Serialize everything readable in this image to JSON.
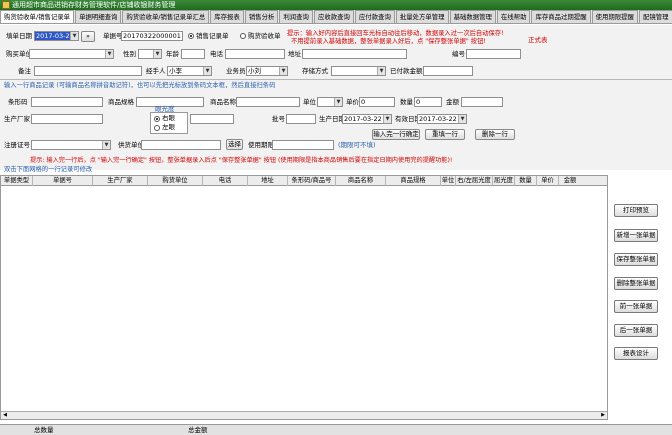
{
  "window": {
    "title": "通用超市商品进销存财务管理软件/店铺收银财务管理"
  },
  "tabs": [
    "购货验收单/销售记录单",
    "单据明细查询",
    "购货验收单/销售记录单汇总",
    "库存报表",
    "销售分析",
    "利润查询",
    "应收款查询",
    "应付款查询",
    "批量处方单管理",
    "基础数据管理",
    "在线帮助",
    "库存商品过期提醒",
    "使用期限提醒",
    "配镜管理"
  ],
  "header": {
    "date_label": "填单日期",
    "date_value": "2017-03-22",
    "goto_icon": "»",
    "docno_label": "单据号",
    "docno_value": "20170322000001",
    "radio_sales": "销售记录单",
    "radio_purchase": "购货验收单",
    "hint": "提示：输入好内容后直接回车光标自动往后移动，数据录入过一次后自动保存!",
    "hint2": "不用提前录入基础数据，整张单据录入好后，点 \"保存整张单据\" 按钮!",
    "mode_label": "正式表"
  },
  "customer": {
    "buyer_label": "购买单位",
    "gender_label": "性别",
    "age_label": "年龄",
    "phone_label": "电话",
    "address_label": "地址",
    "code_label": "编号",
    "remark_label": "备注",
    "agent_label": "经手人",
    "agent_value": "小李",
    "salesman_label": "业务员",
    "salesman_value": "小刘",
    "storage_label": "存储方式",
    "paid_label": "已付款金额"
  },
  "item_hint": "输入一行商品记录 (可输商品名称拼音助记符)，也可以先把光标放到条码文本框，然后直接扫条码",
  "item": {
    "barcode_label": "条形码",
    "spec_label": "商品规格",
    "name_label": "商品名称",
    "unit_label": "单位",
    "price_label": "单价",
    "price_value": "0",
    "qty_label": "数量",
    "qty_value": "0",
    "amount_label": "金额",
    "maker_label": "生产厂家",
    "eye_label": "眼光度",
    "eye_right": "右眼",
    "eye_left": "左眼",
    "batch_label": "批号",
    "prod_date_label": "生产日期",
    "prod_date_value": "2017-03-22",
    "expiry_label": "有效日期",
    "expiry_value": "2017-03-22",
    "enter_btn": "输入完一行确定",
    "reenter_btn": "重填一行",
    "delete_row_btn": "删除一行",
    "reg_label": "注册证号",
    "supplier_label": "供货单位",
    "choose_btn": "选择",
    "period_label": "使用期限",
    "period_note": "(期限可不填)"
  },
  "row_hint": "提示: 输入完一行后，点 \"输入完一行确定\" 按钮，整张单据录入后点 \"保存整张单据\" 按钮 (使用期限是指本商品销售后要在指定日期内使用完的提醒功能)!",
  "grid_caption": "双击下面网格的一行记录可修改",
  "grid": {
    "columns": [
      "单据类型",
      "单据号",
      "生产厂家",
      "购货单位",
      "电话",
      "地址",
      "条形码/商品号",
      "商品名称",
      "商品规格",
      "单位",
      "右/左屈光度",
      "屈光度",
      "数量",
      "单价",
      "金额"
    ]
  },
  "side_buttons": [
    "打印预览",
    "新增一张单据",
    "保存整张单据",
    "删除整张单据",
    "前一张单据",
    "后一张单据",
    "报表设计"
  ],
  "status": {
    "qty_label": "总数量",
    "amount_label": "总金额"
  }
}
